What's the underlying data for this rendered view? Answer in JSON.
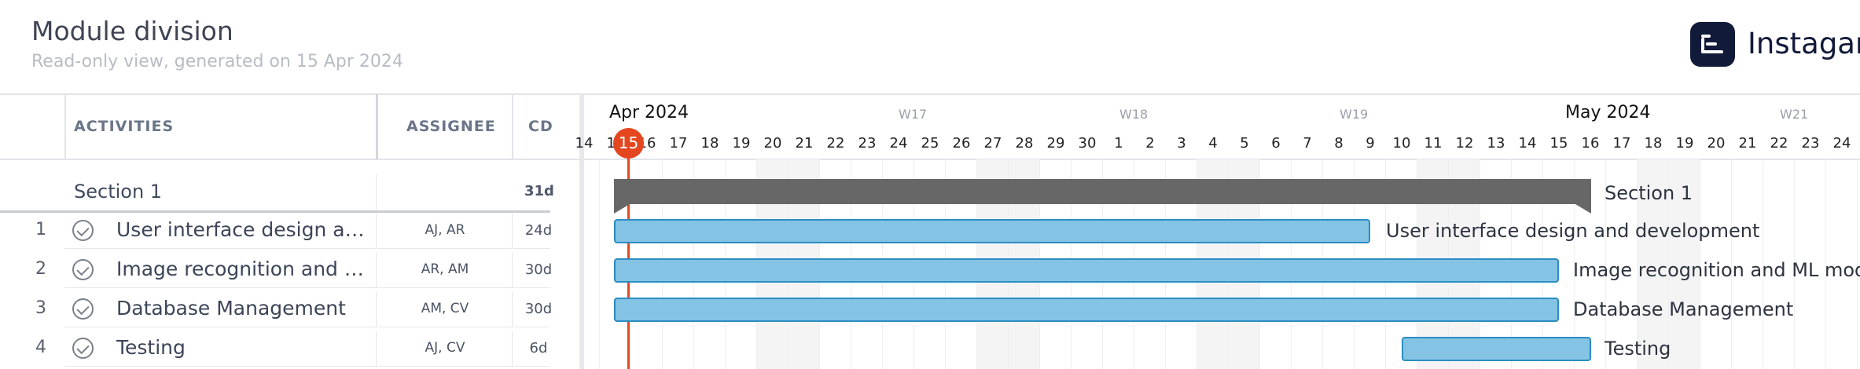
{
  "header": {
    "title": "Module division",
    "subtitle": "Read-only view, generated on 15 Apr 2024",
    "logo_text": "Instagan"
  },
  "columns": {
    "activities": "ACTIVITIES",
    "assignee": "ASSIGNEE",
    "cd": "CD"
  },
  "section": {
    "name": "Section 1",
    "cd": "31d"
  },
  "rows": [
    {
      "num": "1",
      "name": "User interface design and d...",
      "assignee": "AJ, AR",
      "cd": "24d"
    },
    {
      "num": "2",
      "name": "Image recognition and ML ...",
      "assignee": "AR, AM",
      "cd": "30d"
    },
    {
      "num": "3",
      "name": "Database Management",
      "assignee": "AM, CV",
      "cd": "30d"
    },
    {
      "num": "4",
      "name": "Testing",
      "assignee": "AJ, CV",
      "cd": "6d"
    }
  ],
  "timeline": {
    "months": [
      "Apr 2024",
      "May 2024"
    ],
    "weeks": [
      "W17",
      "W18",
      "W19",
      "W21"
    ],
    "days": [
      "14",
      "15",
      "16",
      "17",
      "18",
      "19",
      "20",
      "21",
      "22",
      "23",
      "24",
      "25",
      "26",
      "27",
      "28",
      "29",
      "30",
      "1",
      "2",
      "3",
      "4",
      "5",
      "6",
      "7",
      "8",
      "9",
      "10",
      "11",
      "12",
      "13",
      "14",
      "15",
      "16",
      "17",
      "18",
      "19",
      "20",
      "21",
      "22",
      "23",
      "24"
    ],
    "today": "15",
    "section_bar_label": "Section 1",
    "bars": [
      {
        "label": "User interface design and development"
      },
      {
        "label": "Image recognition and ML model"
      },
      {
        "label": "Database Management"
      },
      {
        "label": "Testing"
      }
    ]
  },
  "colors": {
    "accent_today": "#e4461f",
    "task_bar_fill": "#85c3e4",
    "task_bar_border": "#2b8dc3",
    "section_bar": "#676767",
    "logo": "#121a3a"
  },
  "icons": {
    "row_status": "check-circle-icon",
    "logo": "app-logo-icon"
  }
}
